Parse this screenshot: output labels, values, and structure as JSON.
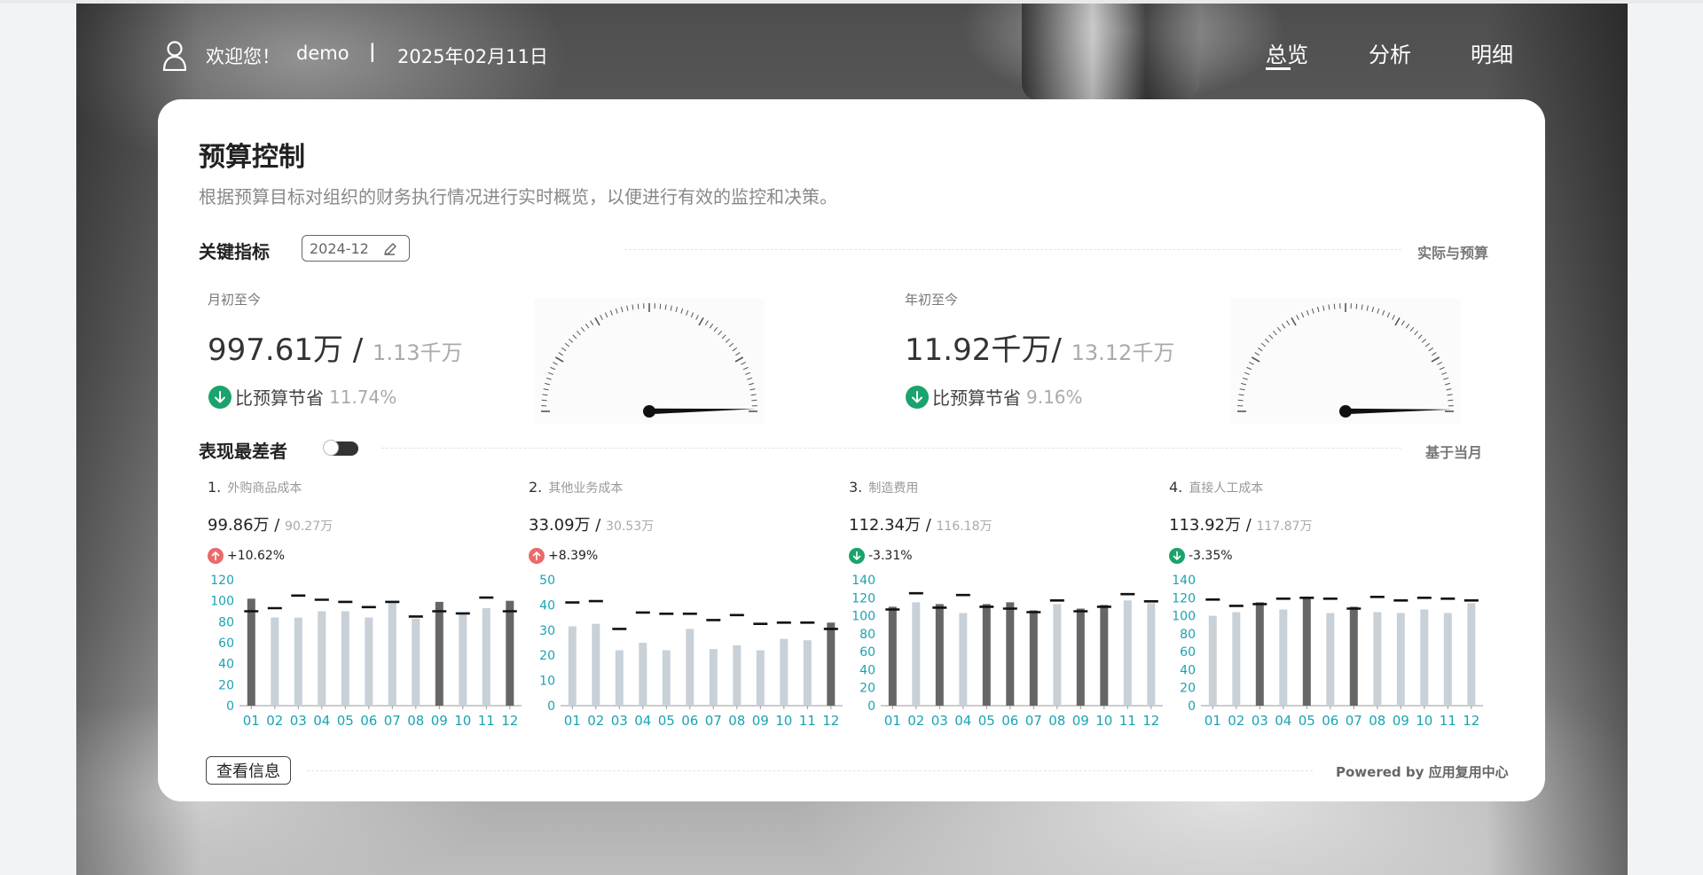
{
  "header": {
    "welcome": "欢迎您！",
    "user": "demo",
    "separator": "|",
    "date": "2025年02月11日",
    "nav": [
      {
        "label": "总览",
        "active": true
      },
      {
        "label": "分析",
        "active": false
      },
      {
        "label": "明细",
        "active": false
      }
    ]
  },
  "page": {
    "title": "预算控制",
    "subtitle": "根据预算目标对组织的财务执行情况进行实时概览，以便进行有效的监控和决策。"
  },
  "key_metrics": {
    "title": "关键指标",
    "period": "2024-12",
    "right_label": "实际与预算",
    "mtd": {
      "label": "月初至今",
      "actual": "997.61万",
      "slash": " / ",
      "budget": "1.13千万",
      "change_label": "比预算节省",
      "change_pct": "11.74%",
      "gauge_ratio": 0.8826
    },
    "ytd": {
      "label": "年初至今",
      "actual": "11.92千万",
      "slash": "/ ",
      "budget": "13.12千万",
      "change_label": "比预算节省",
      "change_pct": "9.16%",
      "gauge_ratio": 0.9084
    }
  },
  "worst": {
    "title": "表现最差者",
    "right_label": "基于当月",
    "items": [
      {
        "rank": "1.",
        "name": "外购商品成本",
        "actual": "99.86万",
        "slash": " / ",
        "budget": "90.27万",
        "change": "+10.62%",
        "direction": "up"
      },
      {
        "rank": "2.",
        "name": "其他业务成本",
        "actual": "33.09万",
        "slash": " / ",
        "budget": "30.53万",
        "change": "+8.39%",
        "direction": "up"
      },
      {
        "rank": "3.",
        "name": "制造费用",
        "actual": "112.34万",
        "slash": " / ",
        "budget": "116.18万",
        "change": "-3.31%",
        "direction": "down"
      },
      {
        "rank": "4.",
        "name": "直接人工成本",
        "actual": "113.92万",
        "slash": " / ",
        "budget": "117.87万",
        "change": "-3.35%",
        "direction": "down"
      }
    ]
  },
  "footer": {
    "button": "查看信息",
    "powered": "Powered by 应用复用中心"
  },
  "colors": {
    "bar_over": "#666666",
    "bar_under": "#c8d0d8",
    "budget_mark": "#111111",
    "axis_text": "#1aa3b3",
    "up": "#ea6a6a",
    "down": "#1aa36c"
  },
  "chart_data": [
    {
      "type": "bar",
      "categories": [
        "01",
        "02",
        "03",
        "04",
        "05",
        "06",
        "07",
        "08",
        "09",
        "10",
        "11",
        "12"
      ],
      "ylim": [
        0,
        120
      ],
      "yticks": [
        0,
        20,
        40,
        60,
        80,
        100,
        120
      ],
      "series": [
        {
          "name": "实际",
          "values": [
            102,
            84,
            84,
            90,
            90,
            84,
            98,
            83,
            99,
            87,
            93,
            100
          ]
        },
        {
          "name": "预算",
          "values": [
            90,
            93,
            105,
            101,
            99,
            94,
            99,
            85,
            90,
            88,
            103,
            90
          ]
        }
      ]
    },
    {
      "type": "bar",
      "categories": [
        "01",
        "02",
        "03",
        "04",
        "05",
        "06",
        "07",
        "08",
        "09",
        "10",
        "11",
        "12"
      ],
      "ylim": [
        0,
        50
      ],
      "yticks": [
        0,
        10,
        20,
        30,
        40,
        50
      ],
      "series": [
        {
          "name": "实际",
          "values": [
            31.5,
            32.5,
            22,
            25,
            22,
            30.5,
            22.5,
            24,
            22,
            26.5,
            26,
            33
          ]
        },
        {
          "name": "预算",
          "values": [
            41,
            41.5,
            30.5,
            37,
            36.5,
            36.5,
            34,
            36,
            32.5,
            33,
            33,
            30.5
          ]
        }
      ]
    },
    {
      "type": "bar",
      "categories": [
        "01",
        "02",
        "03",
        "04",
        "05",
        "06",
        "07",
        "08",
        "09",
        "10",
        "11",
        "12"
      ],
      "ylim": [
        0,
        140
      ],
      "yticks": [
        0,
        20,
        40,
        60,
        80,
        100,
        120,
        140
      ],
      "series": [
        {
          "name": "实际",
          "values": [
            110,
            115,
            113,
            103,
            113,
            115,
            106,
            113,
            108,
            112,
            117,
            114
          ]
        },
        {
          "name": "预算",
          "values": [
            107,
            125,
            109,
            123,
            110,
            108,
            104,
            117,
            105,
            110,
            124,
            116
          ]
        }
      ]
    },
    {
      "type": "bar",
      "categories": [
        "01",
        "02",
        "03",
        "04",
        "05",
        "06",
        "07",
        "08",
        "09",
        "10",
        "11",
        "12"
      ],
      "ylim": [
        0,
        140
      ],
      "yticks": [
        0,
        20,
        40,
        60,
        80,
        100,
        120,
        140
      ],
      "series": [
        {
          "name": "实际",
          "values": [
            100,
            104,
            115,
            107,
            121,
            103,
            110,
            104,
            103,
            107,
            103,
            114
          ]
        },
        {
          "name": "预算",
          "values": [
            118,
            111,
            113,
            119,
            120,
            119,
            108,
            121,
            117,
            120,
            119,
            117
          ]
        }
      ]
    }
  ]
}
